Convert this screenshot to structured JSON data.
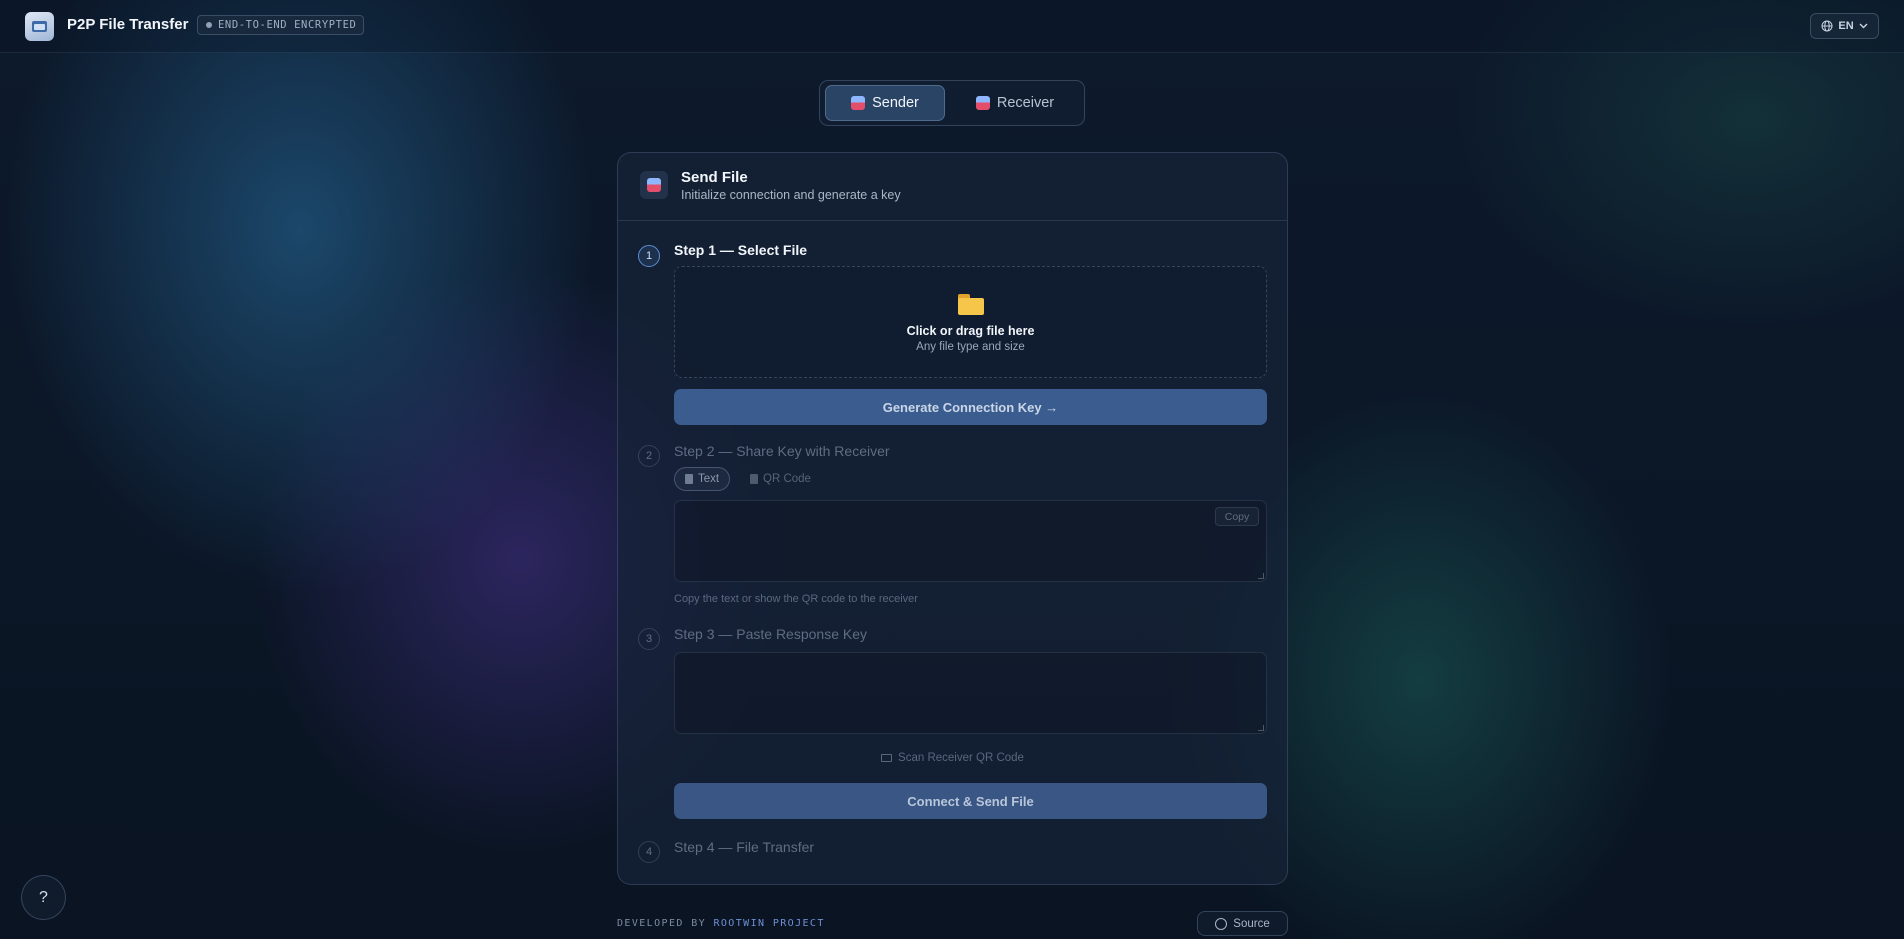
{
  "header": {
    "app_title": "P2P File Transfer",
    "encryption_badge": "END-TO-END ENCRYPTED",
    "language": "EN"
  },
  "mode_toggle": {
    "sender_label": "Sender",
    "receiver_label": "Receiver",
    "active": "Sender"
  },
  "card": {
    "title": "Send File",
    "subtitle": "Initialize connection and generate a key",
    "steps": [
      {
        "number": "1",
        "title": "Step 1 — Select File",
        "state": "active"
      },
      {
        "number": "2",
        "title": "Step 2 — Share Key with Receiver",
        "state": "inactive"
      },
      {
        "number": "3",
        "title": "Step 3 — Paste Response Key",
        "state": "inactive"
      },
      {
        "number": "4",
        "title": "Step 4 — File Transfer",
        "state": "inactive"
      }
    ],
    "dropzone": {
      "title": "Click or drag file here",
      "subtitle": "Any file type and size"
    },
    "generate_button": "Generate Connection Key →",
    "share_tabs": {
      "text_label": "Text",
      "qr_label": "QR Code",
      "active": "Text"
    },
    "copy_label": "Copy",
    "share_hint": "Copy the text or show the QR code to the receiver",
    "scan_link": "Scan Receiver QR Code",
    "connect_button": "Connect & Send File"
  },
  "footer": {
    "developed_by": "DEVELOPED BY",
    "brand": "ROOTWIN PROJECT",
    "source_label": "Source"
  },
  "help_button": "?",
  "colors": {
    "background": "#0b1626",
    "accent": "#3b5c8e",
    "brand_link": "#6f90d6"
  }
}
